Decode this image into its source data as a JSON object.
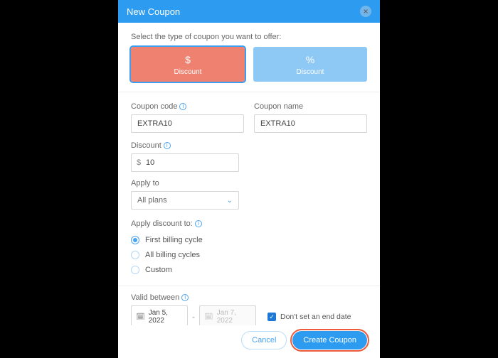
{
  "header": {
    "title": "New Coupon"
  },
  "intro": "Select the type of coupon you want to offer:",
  "types": {
    "dollar": {
      "symbol": "$",
      "label": "Discount"
    },
    "percent": {
      "symbol": "%",
      "label": "Discount"
    }
  },
  "fields": {
    "coupon_code": {
      "label": "Coupon code",
      "value": "EXTRA10"
    },
    "coupon_name": {
      "label": "Coupon name",
      "value": "EXTRA10"
    },
    "discount": {
      "label": "Discount",
      "prefix": "$",
      "value": "10"
    },
    "apply_to": {
      "label": "Apply to",
      "value": "All plans"
    },
    "apply_discount_to": {
      "label": "Apply discount to:",
      "options": [
        "First billing cycle",
        "All billing cycles",
        "Custom"
      ],
      "selected": 0
    },
    "valid_between": {
      "label": "Valid between",
      "start": "Jan 5, 2022",
      "end": "Jan 7, 2022",
      "no_end_label": "Don't set an end date",
      "no_end_checked": true
    }
  },
  "footer": {
    "cancel": "Cancel",
    "create": "Create Coupon"
  }
}
